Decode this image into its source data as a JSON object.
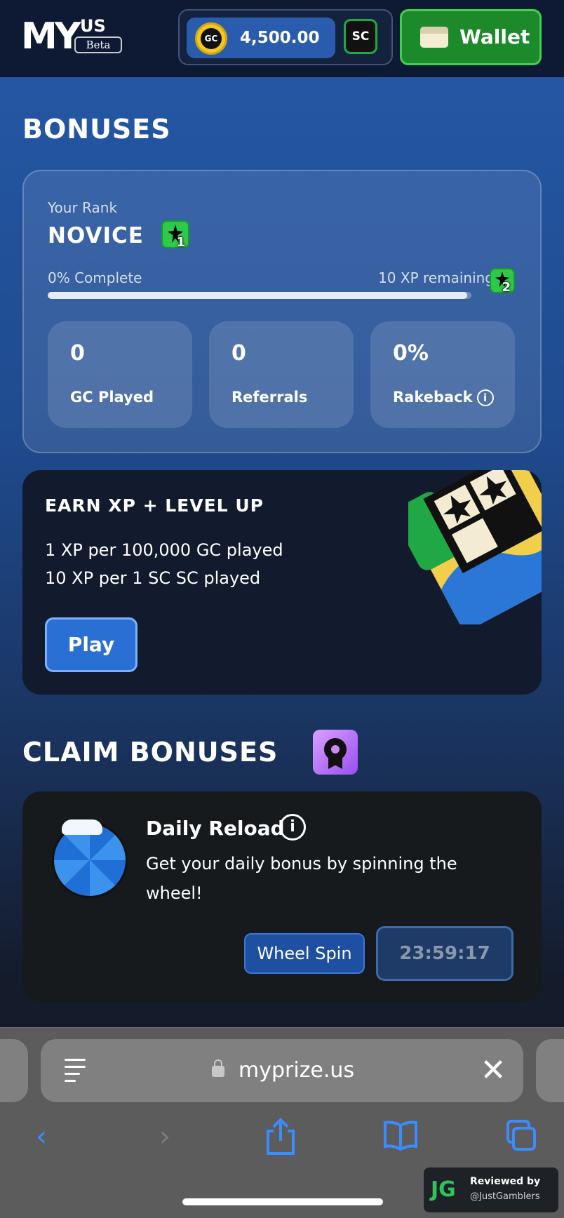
{
  "header": {
    "logo_main": "MY",
    "logo_region": "US",
    "logo_badge": "Beta",
    "gc_coin_label": "GC",
    "balance": "4,500.00",
    "sc_label": "SC",
    "wallet_label": "Wallet"
  },
  "bonuses": {
    "heading": "BONUSES",
    "rank_label": "Your Rank",
    "rank_name": "NOVICE",
    "current_level": "1",
    "next_level": "2",
    "progress_text": "0% Complete",
    "progress_fraction": 0.99,
    "xp_remaining": "10 XP remaining",
    "stats": [
      {
        "value": "0",
        "label": "GC Played"
      },
      {
        "value": "0",
        "label": "Referrals"
      },
      {
        "value": "0%",
        "label": "Rakeback"
      }
    ],
    "info_glyph": "i"
  },
  "earn": {
    "title": "EARN XP + LEVEL UP",
    "line1": "1 XP per 100,000 GC played",
    "line2": "10 XP per 1 SC SC played",
    "play_label": "Play"
  },
  "claim": {
    "heading": "CLAIM BONUSES",
    "daily_title": "Daily Reload",
    "daily_desc": "Get your daily bonus by spinning the wheel!",
    "wheel_spin_label": "Wheel Spin",
    "timer": "23:59:17"
  },
  "browser": {
    "url": "myprize.us",
    "close_glyph": "✕",
    "back_glyph": "‹",
    "forward_glyph": "›"
  },
  "watermark": {
    "logo": "JG",
    "line1": "Reviewed by",
    "line2": "@JustGamblers"
  },
  "colors": {
    "accent_blue": "#2a6fd4",
    "wallet_green": "#1c8a2a",
    "badge_green": "#2ec84a",
    "gold_coin": "#f4c824"
  },
  "icons": [
    "gc-coin-icon",
    "sc-icon",
    "wallet-icon",
    "rank-badge-icon",
    "info-icon",
    "ribbon-icon",
    "wheel-icon",
    "reader-icon",
    "lock-icon",
    "close-icon",
    "back-icon",
    "forward-icon",
    "share-icon",
    "bookmarks-icon",
    "tabs-icon"
  ]
}
